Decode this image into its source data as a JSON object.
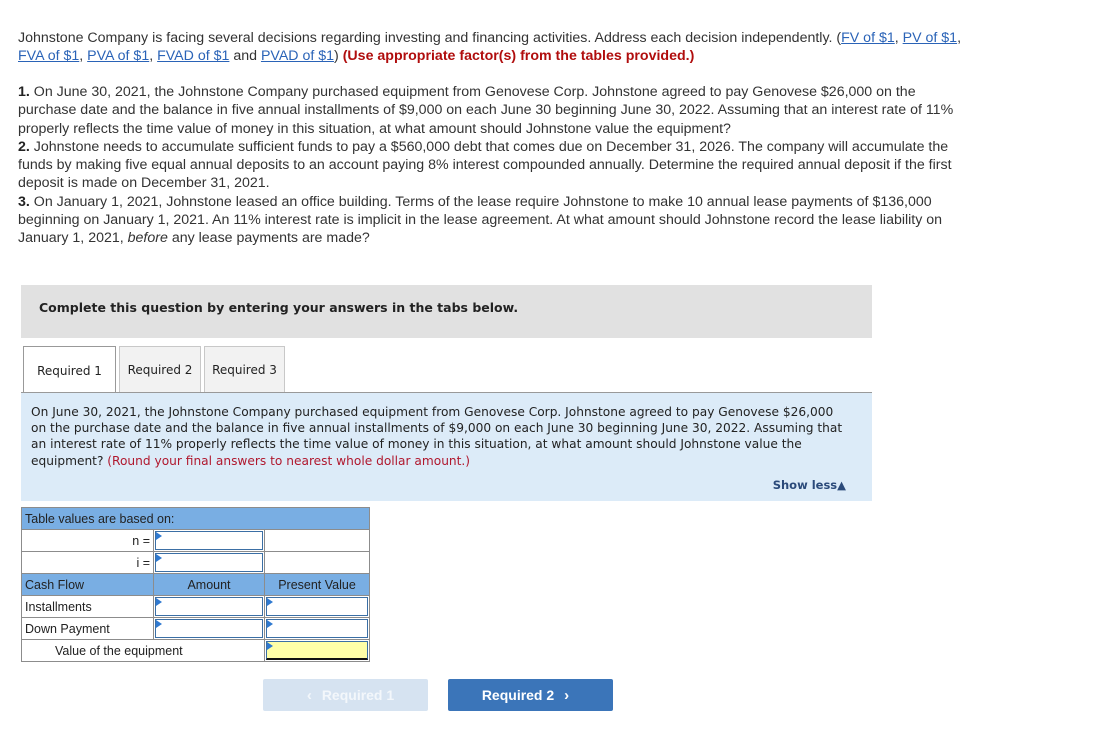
{
  "intro": {
    "text_before": "Johnstone Company is facing several decisions regarding investing and financing activities. Address each decision independently. (",
    "links": [
      "FV of $1",
      "PV of $1",
      "FVA of $1",
      "PVA of $1",
      "FVAD of $1",
      "PVAD of $1"
    ],
    "sep1": ", ",
    "and": " and ",
    "close": ") ",
    "instruction": "(Use appropriate factor(s) from the tables provided.)"
  },
  "questions": [
    {
      "num": "1.",
      "text": " On June 30, 2021, the Johnstone Company purchased equipment from Genovese Corp. Johnstone agreed to pay Genovese $26,000 on the purchase date and the balance in five annual installments of $9,000 on each June 30 beginning June 30, 2022. Assuming that an interest rate of 11% properly reflects the time value of money in this situation, at what amount should Johnstone value the equipment?"
    },
    {
      "num": "2.",
      "text": " Johnstone needs to accumulate sufficient funds to pay a $560,000 debt that comes due on December 31, 2026. The company will accumulate the funds by making five equal annual deposits to an account paying 8% interest compounded annually. Determine the required annual deposit if the first deposit is made on December 31, 2021."
    },
    {
      "num": "3.",
      "text_a": " On January 1, 2021, Johnstone leased an office building. Terms of the lease require Johnstone to make 10 annual lease payments of $136,000 beginning on January 1, 2021. An 11% interest rate is implicit in the lease agreement. At what amount should Johnstone record the lease liability on January 1, 2021, ",
      "italic": "before",
      "text_b": " any lease payments are made?"
    }
  ],
  "complete_box": "Complete this question by entering your answers in the tabs below.",
  "tabs": [
    {
      "label": "Required 1",
      "active": true
    },
    {
      "label": "Required 2",
      "active": false
    },
    {
      "label": "Required 3",
      "active": false
    }
  ],
  "panel": {
    "text": "On June 30, 2021, the Johnstone Company purchased equipment from Genovese Corp. Johnstone agreed to pay Genovese $26,000 on the purchase date and the balance in five annual installments of $9,000 on each June 30 beginning June 30, 2022. Assuming that an interest rate of 11% properly reflects the time value of money in this situation, at what amount should Johnstone value the equipment? ",
    "instruction": "(Round your final answers to nearest whole dollar amount.)",
    "show_less": "Show less",
    "show_less_icon": "▲"
  },
  "table": {
    "header": "Table values are based on:",
    "n_label": "n =",
    "i_label": "i =",
    "n_value": "",
    "i_value": "",
    "col_headers": [
      "Cash Flow",
      "Amount",
      "Present Value"
    ],
    "rows": [
      {
        "label": "Installments",
        "amount": "",
        "present_value": ""
      },
      {
        "label": "Down Payment",
        "amount": "",
        "present_value": ""
      }
    ],
    "total_label": "Value of the equipment",
    "total_value": ""
  },
  "nav": {
    "prev_label": "Required 1",
    "prev_icon": "‹",
    "next_label": "Required 2",
    "next_icon": "›"
  }
}
